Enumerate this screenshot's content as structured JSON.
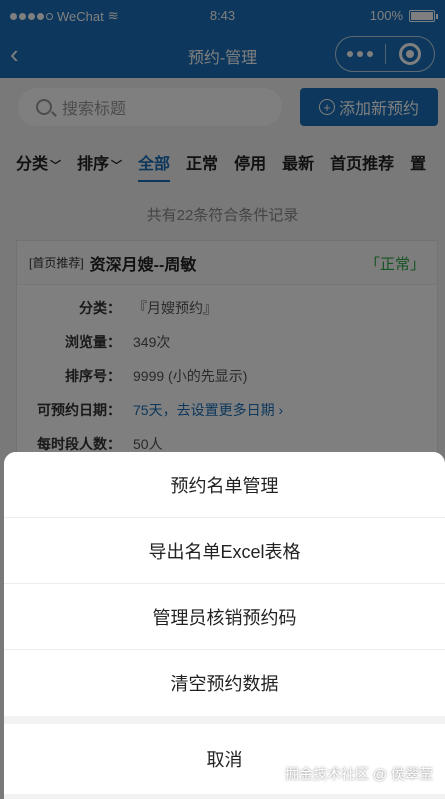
{
  "status_bar": {
    "carrier": "WeChat",
    "time": "8:43",
    "battery": "100%"
  },
  "nav": {
    "back_icon": "chevron-left-icon",
    "title": "预约-管理"
  },
  "search": {
    "placeholder": "搜索标题"
  },
  "add_button": {
    "label": "添加新预约"
  },
  "filters": {
    "category": "分类",
    "sort": "排序",
    "tabs": [
      "全部",
      "正常",
      "停用",
      "最新",
      "首页推荐",
      "置"
    ],
    "active": "全部"
  },
  "count_text": "共有22条符合条件记录",
  "card": {
    "tag": "[首页推荐]",
    "name": "资深月嫂--周敏",
    "status": "「正常」",
    "rows": [
      {
        "k": "分类：",
        "v": "『月嫂预约』"
      },
      {
        "k": "浏览量：",
        "v": "349次"
      },
      {
        "k": "排序号：",
        "v": "9999 (小的先显示)"
      },
      {
        "k": "可预约日期：",
        "v": "75天，去设置更多日期 ›"
      },
      {
        "k": "每时段人数：",
        "v": "50人"
      }
    ]
  },
  "action_sheet": {
    "items": [
      "预约名单管理",
      "导出名单Excel表格",
      "管理员核销预约码",
      "清空预约数据"
    ],
    "cancel": "取消"
  },
  "watermark": "掘金技术社区 @ 侯翠莹",
  "colors": {
    "brand": "#1a6fb8",
    "status_ok": "#2ea84a"
  }
}
